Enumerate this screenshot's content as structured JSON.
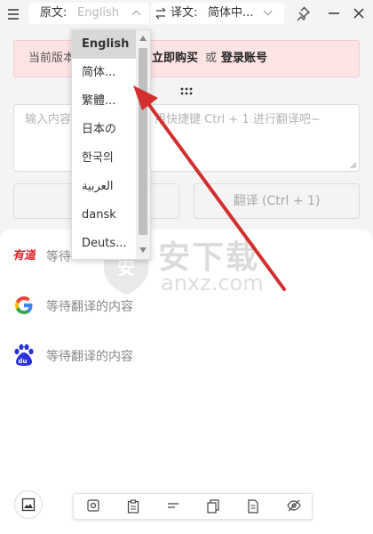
{
  "titlebar": {
    "source_label": "原文:",
    "source_placeholder": "English",
    "target_label": "译文:",
    "target_value": "简体中...",
    "icons": [
      "menu-icon",
      "swap-icon",
      "pin-icon",
      "minimize-icon",
      "close-icon"
    ]
  },
  "dropdown": {
    "options": [
      "English",
      "简体...",
      "繁體...",
      "日本の",
      "한국의",
      "العربية",
      "dansk",
      "Deuts..."
    ],
    "selected": "English"
  },
  "banner": {
    "prefix": "当前版本",
    "buy_link": "立即购买",
    "connector": "或",
    "login_link": "登录账号"
  },
  "source": {
    "placeholder_left": "输入内容",
    "placeholder_right": "用快捷键 Ctrl + 1 进行翻译吧~"
  },
  "actions": {
    "translate_label": "翻译 (Ctrl + 1)"
  },
  "results": [
    {
      "engine": "youdao",
      "text": "等待"
    },
    {
      "engine": "google",
      "text": "等待翻译的内容"
    },
    {
      "engine": "baidu",
      "text": "等待翻译的内容"
    }
  ],
  "watermark": {
    "cn": "安下载",
    "en": "anxz.com"
  },
  "colors": {
    "accent_arrow": "#d32f2f",
    "banner_bg": "#fde4e4",
    "youdao_red": "#e0242b",
    "baidu_blue": "#2932e1"
  }
}
